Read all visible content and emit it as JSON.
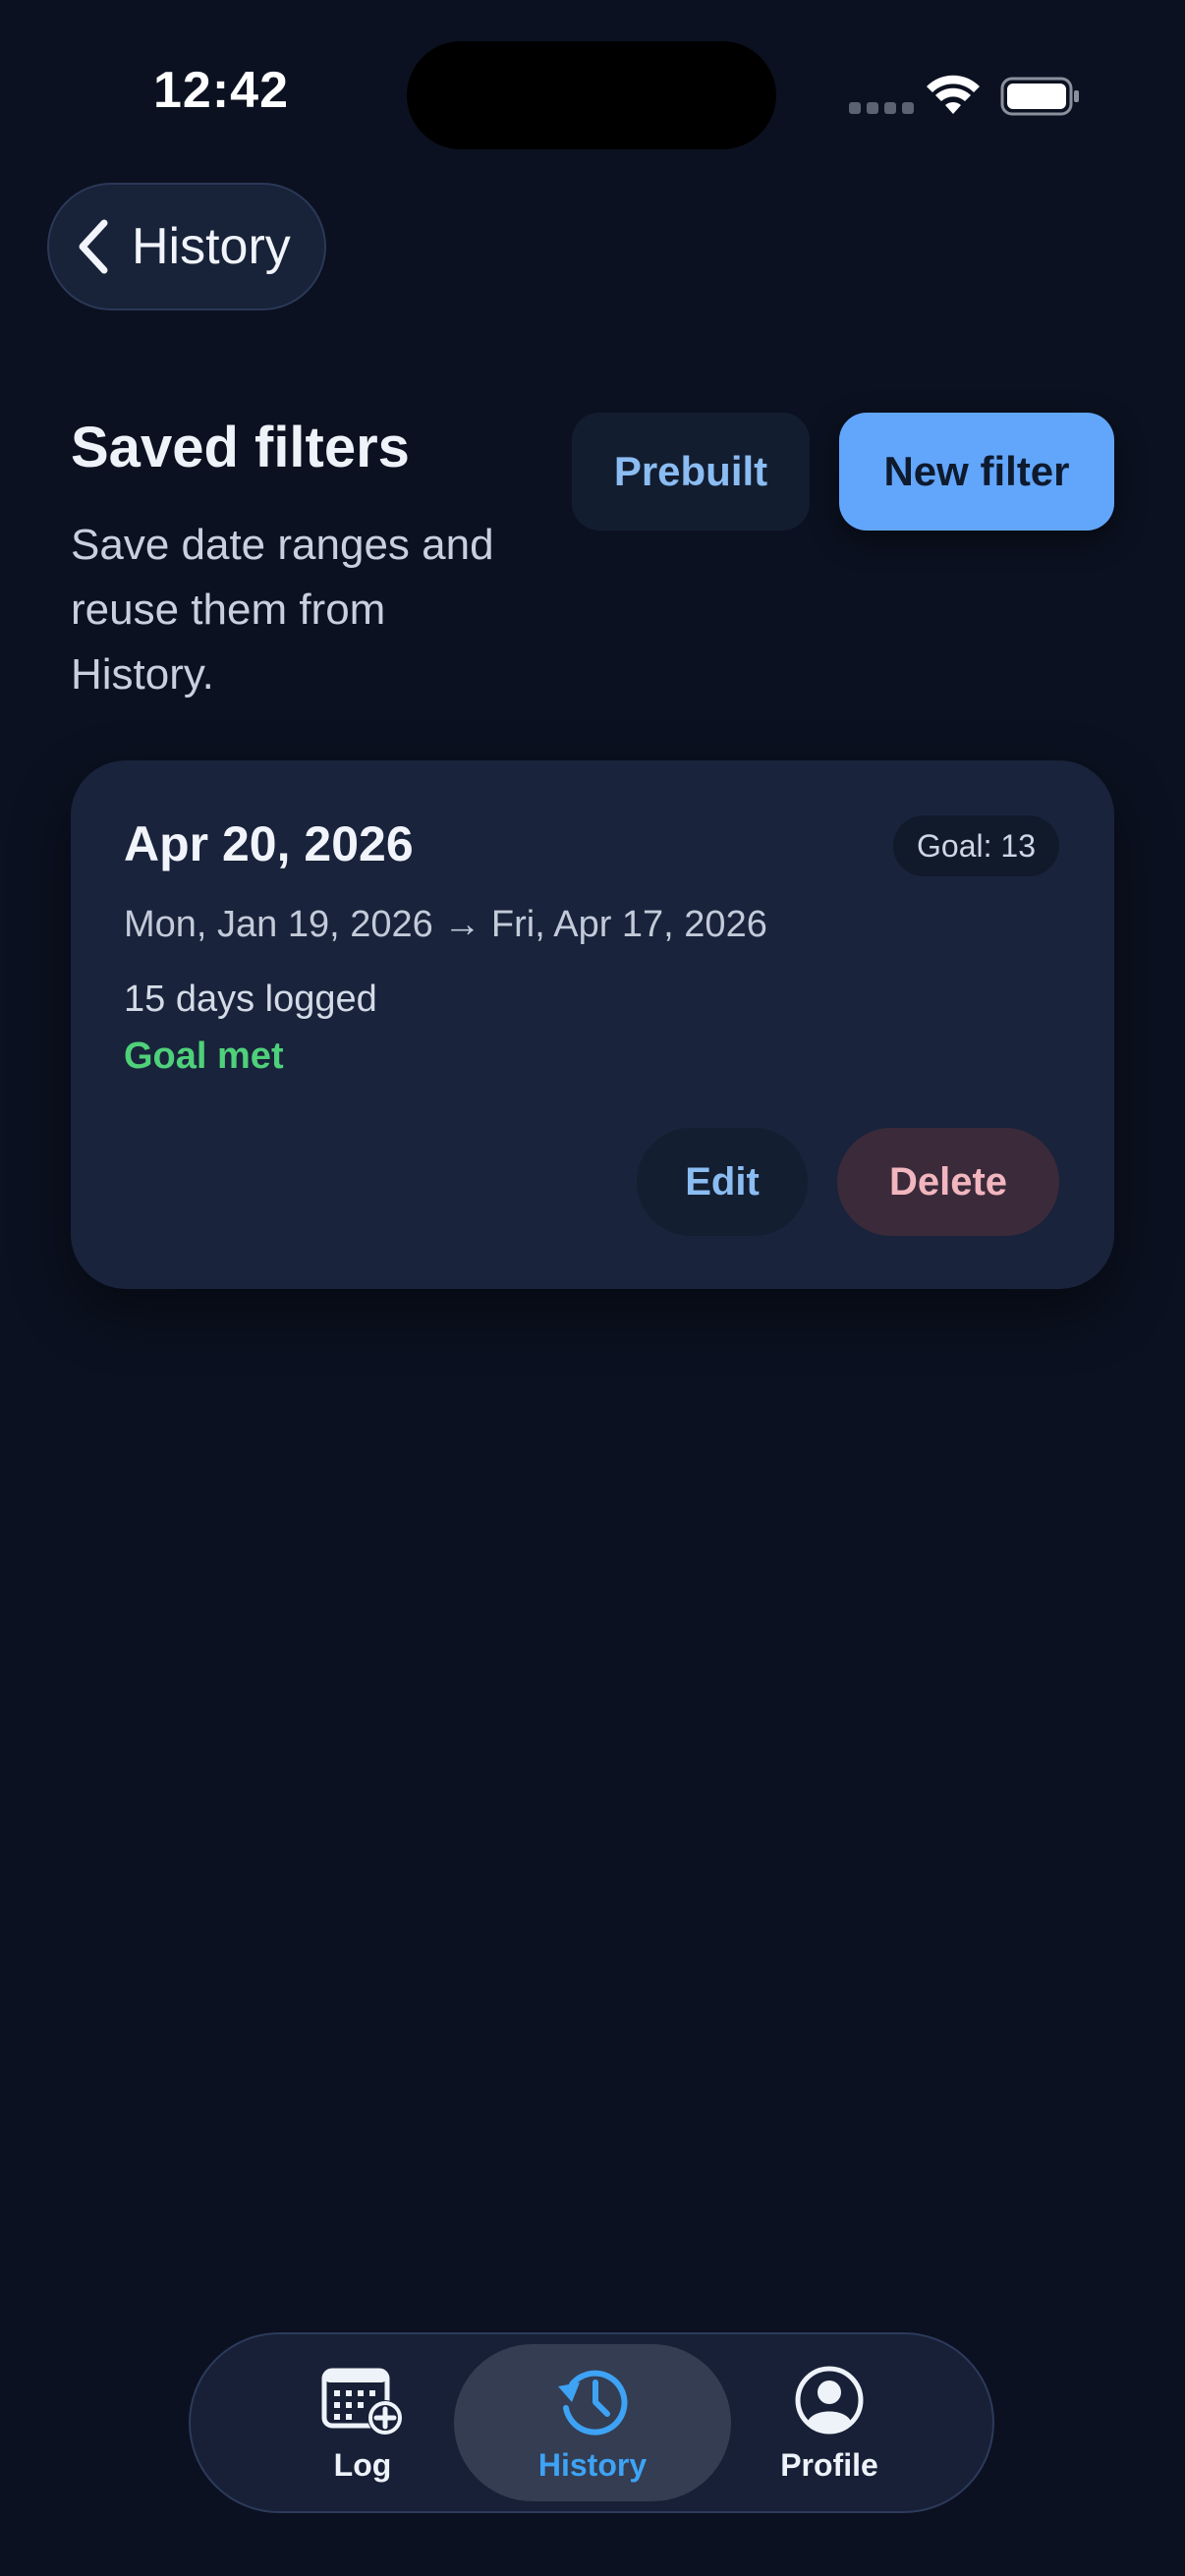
{
  "status_bar": {
    "time": "12:42"
  },
  "nav": {
    "back_label": "History",
    "back_icon": "chevron-left-icon"
  },
  "header": {
    "title": "Saved filters",
    "subtitle": "Save date ranges and reuse them from History.",
    "prebuilt_label": "Prebuilt",
    "new_filter_label": "New filter"
  },
  "filters": [
    {
      "title": "Apr 20, 2026",
      "goal_badge": "Goal: 13",
      "range": "Mon, Jan 19, 2026 → Fri, Apr 17, 2026",
      "days_logged": "15 days logged",
      "status": "Goal met",
      "edit_label": "Edit",
      "delete_label": "Delete"
    }
  ],
  "tab_bar": {
    "tabs": [
      {
        "label": "Log",
        "icon": "calendar-add-icon",
        "active": false
      },
      {
        "label": "History",
        "icon": "history-clock-icon",
        "active": true
      },
      {
        "label": "Profile",
        "icon": "profile-icon",
        "active": false
      }
    ]
  },
  "colors": {
    "background": "#0b1120",
    "card": "#19233b",
    "accent": "#62a6fb",
    "active_tab": "#3ea3f5",
    "success": "#4fd07a",
    "danger_text": "#f2b6bf"
  }
}
